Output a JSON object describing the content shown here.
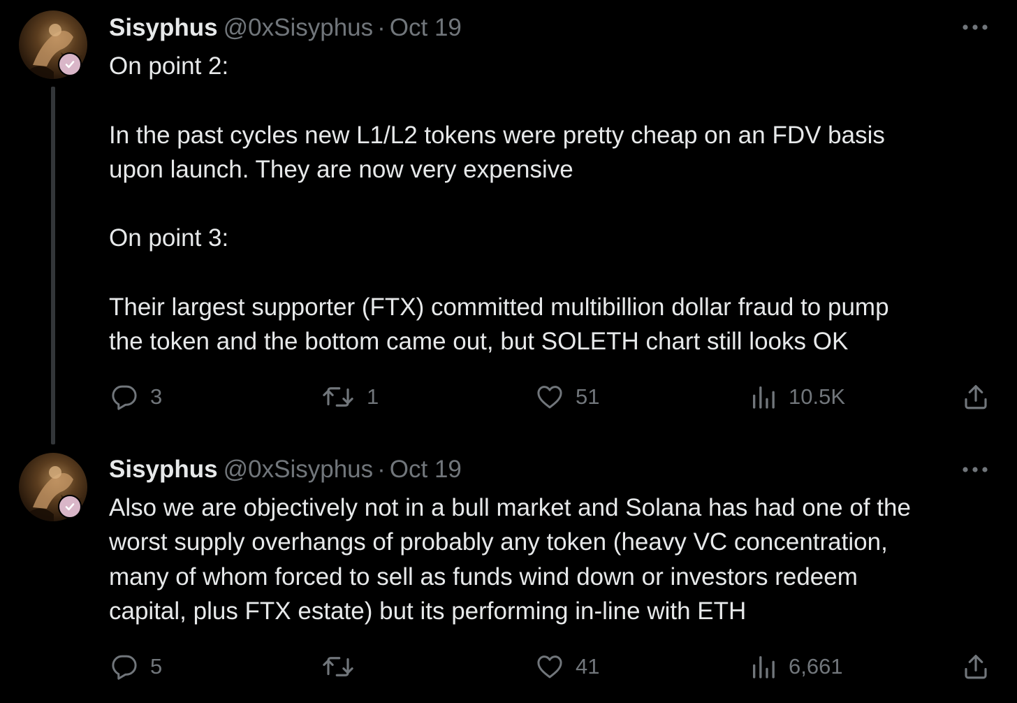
{
  "tweets": [
    {
      "display_name": "Sisyphus",
      "handle": "@0xSisyphus",
      "separator": "·",
      "date": "Oct 19",
      "text": "On point 2:\n\nIn the past cycles new L1/L2 tokens were pretty cheap on an FDV basis\nupon launch. They are now very expensive\n\nOn point 3:\n\nTheir largest supporter (FTX) committed multibillion dollar fraud to pump\nthe token and the bottom came out, but SOLETH chart still looks OK",
      "replies": "3",
      "reposts": "1",
      "likes": "51",
      "views": "10.5K"
    },
    {
      "display_name": "Sisyphus",
      "handle": "@0xSisyphus",
      "separator": "·",
      "date": "Oct 19",
      "text": "Also we are objectively not in a bull market and Solana has had one of the\nworst supply overhangs of probably any token (heavy VC concentration,\nmany of whom forced to sell as funds wind down or investors redeem\ncapital, plus FTX estate) but its performing in-line with ETH",
      "replies": "5",
      "reposts": "",
      "likes": "41",
      "views": "6,661"
    }
  ],
  "icons": {
    "more": "more-dots-icon",
    "reply": "reply-bubble-icon",
    "repost": "repost-arrows-icon",
    "like": "heart-icon",
    "views": "views-bar-chart-icon",
    "share": "share-upload-icon",
    "verified": "verified-badge-icon"
  },
  "colors": {
    "background": "#000000",
    "text": "#e7e9ea",
    "secondary": "#71767b",
    "thread_line": "#333639",
    "badge": "#d9b6c8"
  }
}
